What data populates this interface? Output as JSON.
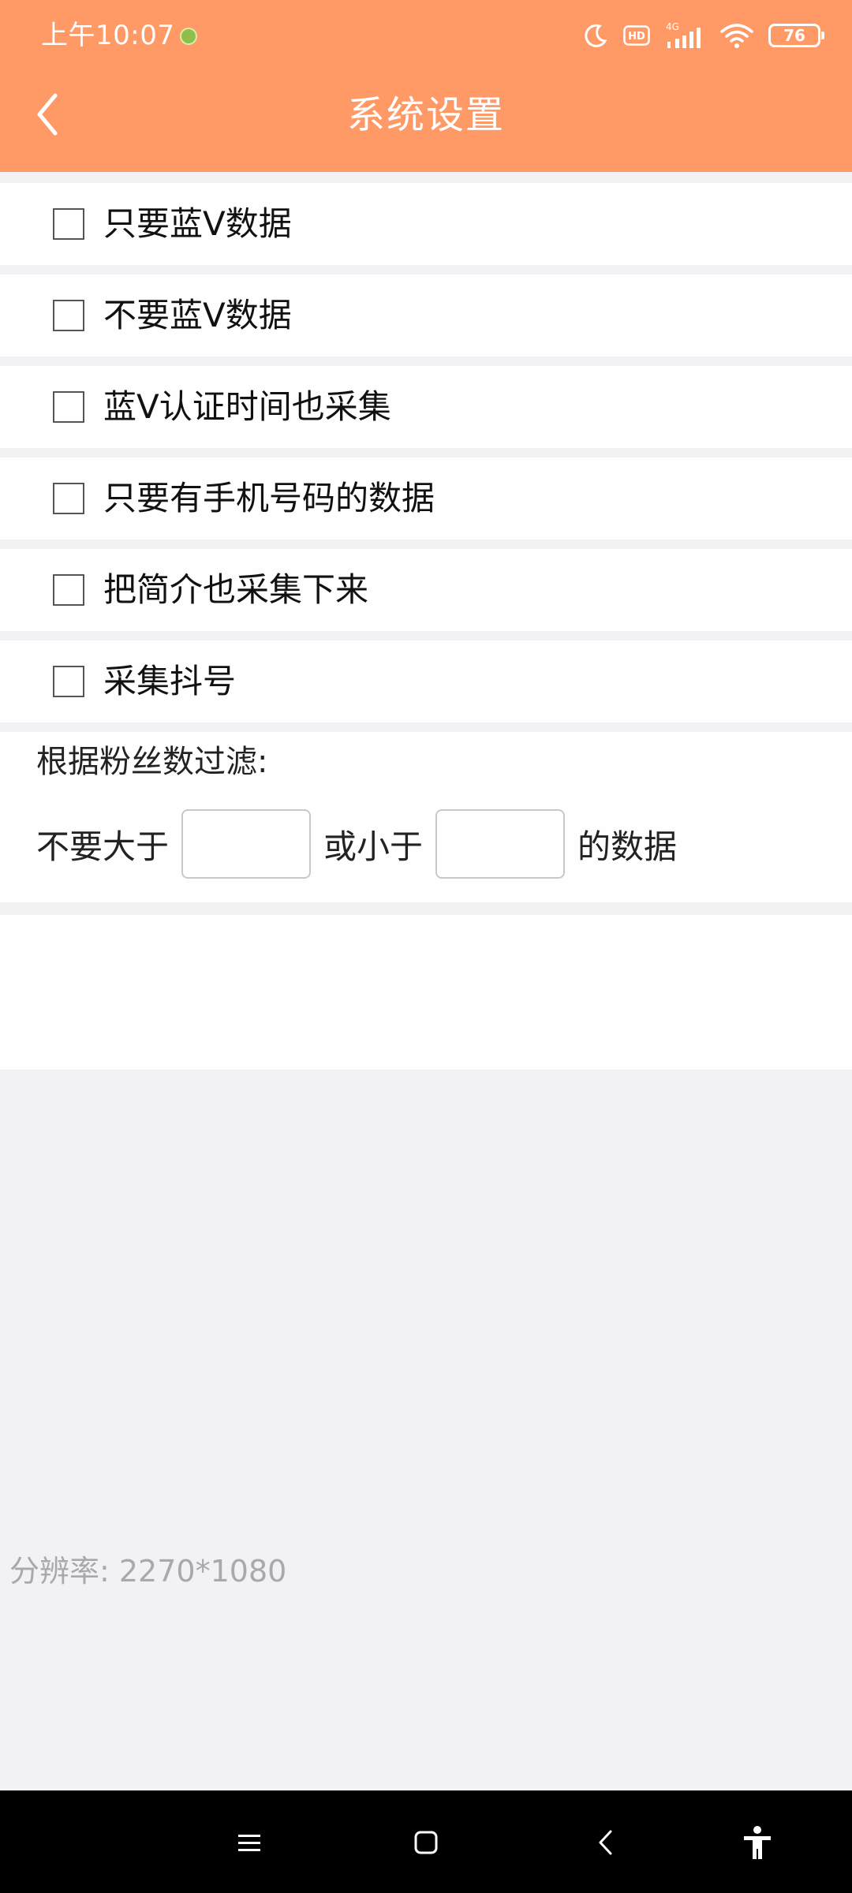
{
  "status_bar": {
    "time": "上午10:07",
    "network": "4G",
    "hd": "HD",
    "battery": "76"
  },
  "title_bar": {
    "title": "系统设置"
  },
  "options": [
    {
      "label": "只要蓝V数据",
      "checked": false
    },
    {
      "label": "不要蓝V数据",
      "checked": false
    },
    {
      "label": "蓝V认证时间也采集",
      "checked": false
    },
    {
      "label": "只要有手机号码的数据",
      "checked": false
    },
    {
      "label": "把简介也采集下来",
      "checked": false
    },
    {
      "label": "采集抖号",
      "checked": false
    }
  ],
  "filter": {
    "title": "根据粉丝数过滤:",
    "prefix": "不要大于",
    "max_value": "",
    "middle": "或小于",
    "min_value": "",
    "suffix": "的数据"
  },
  "footer": {
    "resolution": "分辨率: 2270*1080"
  },
  "colors": {
    "header": "#ff9966",
    "page_background": "#f2f2f4",
    "nav_bar": "#000000"
  },
  "icons": [
    "back-arrow-icon",
    "moon-icon",
    "signal-icon",
    "wifi-icon",
    "menu-icon",
    "home-icon",
    "nav-back-icon",
    "accessibility-icon"
  ]
}
